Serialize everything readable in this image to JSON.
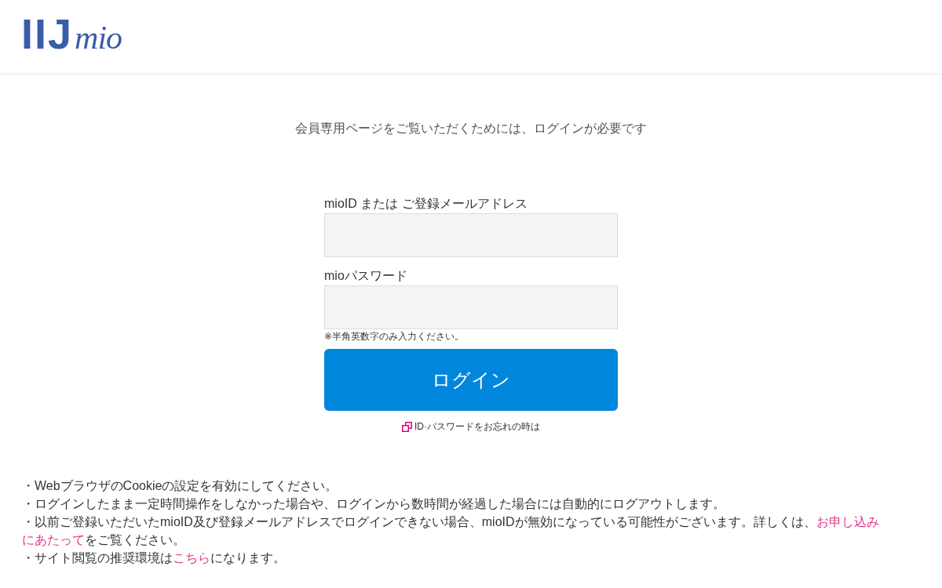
{
  "header": {
    "logo": {
      "brand": "IIJ",
      "suffix": "mio"
    }
  },
  "message": "会員専用ページをご覧いただくためには、ログインが必要です",
  "form": {
    "fields": [
      {
        "label": "mioID または ご登録メールアドレス"
      },
      {
        "label": "mioパスワード",
        "hint": "※半角英数字のみ入力ください。"
      }
    ],
    "submit": "ログイン",
    "forgot_link": "ID·パスワードをお忘れの時は"
  },
  "notes": [
    {
      "segments": [
        {
          "kind": "text",
          "text": "・WebブラウザのCookieの設定を有効にしてください。"
        }
      ]
    },
    {
      "segments": [
        {
          "kind": "text",
          "text": "・ログインしたまま一定時間操作をしなかった場合や、ログインから数時間が経過した場合には自動的にログアウトします。"
        }
      ]
    },
    {
      "segments": [
        {
          "kind": "text",
          "text": "・以前ご登録いただいたmioID及び登録メールアドレスでログインできない場合、mioIDが無効になっている可能性がございます。詳しくは、"
        },
        {
          "kind": "link",
          "text": "お申し込み"
        },
        {
          "kind": "link",
          "text": "にあたって"
        },
        {
          "kind": "text",
          "text": "をご覧ください。"
        }
      ]
    },
    {
      "segments": [
        {
          "kind": "text",
          "text": "・サイト閲覧の推奨環境は"
        },
        {
          "kind": "link",
          "text": "こちら"
        },
        {
          "kind": "text",
          "text": "になります。"
        }
      ]
    }
  ]
}
